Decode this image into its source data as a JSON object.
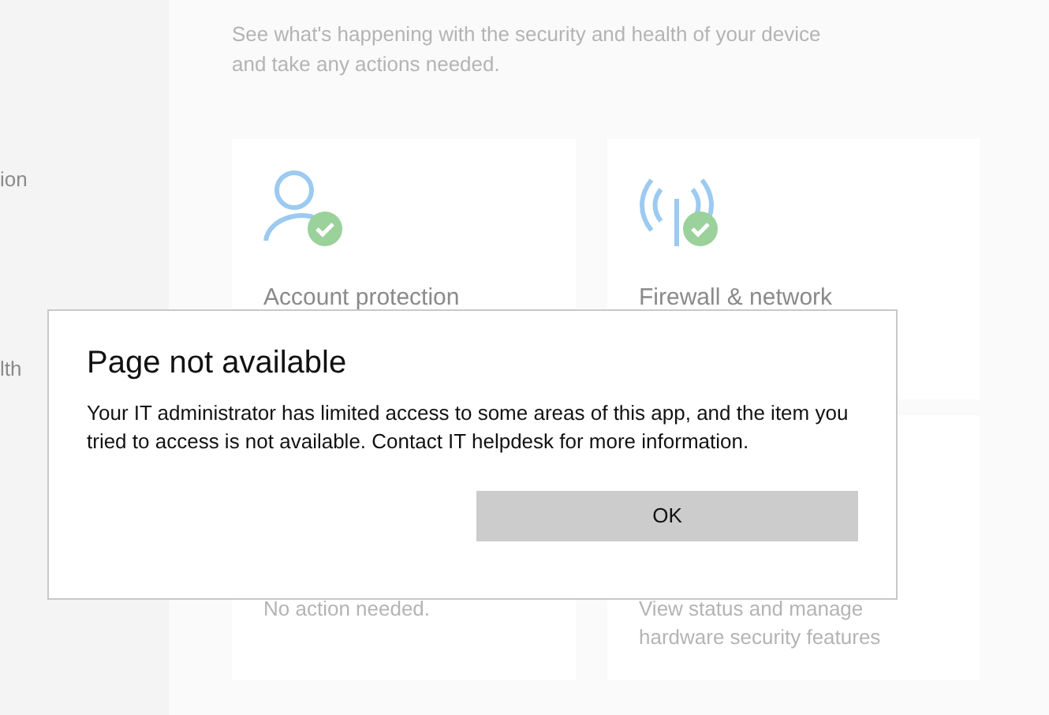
{
  "sidebar": {
    "items": [
      {
        "label": "ion"
      },
      {
        "label": "lth"
      }
    ]
  },
  "header": {
    "description": "See what's happening with the security and health of your device and take any actions needed."
  },
  "cards": [
    {
      "kind": "account",
      "title": "Account protection",
      "protected": true
    },
    {
      "kind": "firewall",
      "title": "Firewall & network",
      "protected": true
    },
    {
      "kind": "plain",
      "subtitle": "No action needed."
    },
    {
      "kind": "plain",
      "subtitle": "View status and manage hardware security features"
    }
  ],
  "dialog": {
    "title": "Page not available",
    "message": "Your IT administrator has limited access to some areas of this app, and the item you tried to access is not available. Contact IT helpdesk for more information.",
    "buttons": [
      "OK"
    ]
  }
}
